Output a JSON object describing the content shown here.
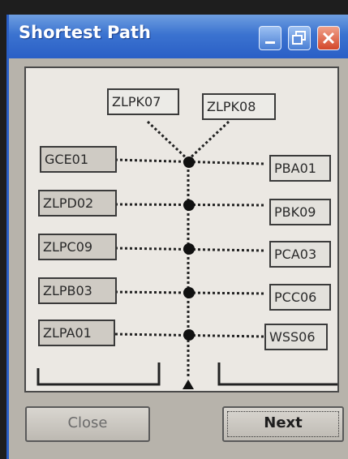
{
  "window": {
    "title": "Shortest Path"
  },
  "titlebar_buttons": {
    "minimize_icon": "minimize-icon",
    "maximize_icon": "maximize-icon",
    "close_icon": "close-icon"
  },
  "nodes": {
    "top": [
      "ZLPK07",
      "ZLPK08"
    ],
    "left": [
      "GCE01",
      "ZLPD02",
      "ZLPC09",
      "ZLPB03",
      "ZLPA01"
    ],
    "right": [
      "PBA01",
      "PBK09",
      "PCA03",
      "PCC06",
      "WSS06"
    ]
  },
  "buttons": {
    "close_label": "Close",
    "next_label": "Next"
  },
  "colors": {
    "titlebar": "#2a5fc6",
    "panel": "#ebe8e3",
    "line": "#222222"
  }
}
